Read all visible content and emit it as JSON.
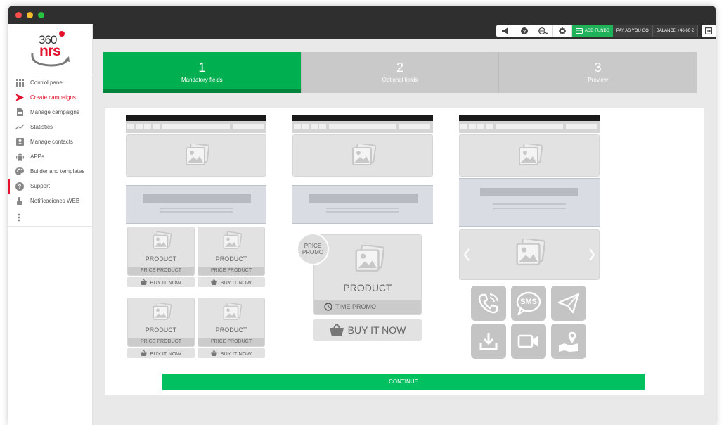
{
  "sidebar": {
    "logo": {
      "number": "360",
      "brand": "nrs"
    },
    "items": [
      {
        "label": "Control panel"
      },
      {
        "label": "Create campaigns"
      },
      {
        "label": "Manage campaigns"
      },
      {
        "label": "Statistics"
      },
      {
        "label": "Manage contacts"
      },
      {
        "label": "APPs"
      },
      {
        "label": "Builder and templates"
      },
      {
        "label": "Support"
      },
      {
        "label": "Notificaciones WEB"
      }
    ]
  },
  "topbar": {
    "add_funds": "ADD FUNDS",
    "pay_as_you_go": "PAY AS YOU GO",
    "balance": "BALANCE +46.60 €"
  },
  "steps": [
    {
      "number": "1",
      "label": "Mandatory fields"
    },
    {
      "number": "2",
      "label": "Optional fields"
    },
    {
      "number": "3",
      "label": "Preview"
    }
  ],
  "template1": {
    "product": "PRODUCT",
    "price": "PRICE PRODUCT",
    "buy": "BUY IT NOW"
  },
  "template2": {
    "badge_line1": "PRICE",
    "badge_line2": "PROMO",
    "product": "PRODUCT",
    "time": "TIME PROMO",
    "buy": "BUY IT NOW"
  },
  "template3": {
    "sms": "SMS"
  },
  "continue_label": "CONTINUE",
  "colors": {
    "accent_green": "#00b050",
    "active_red": "#e4102c",
    "placeholder_gray": "#e2e2e2"
  }
}
